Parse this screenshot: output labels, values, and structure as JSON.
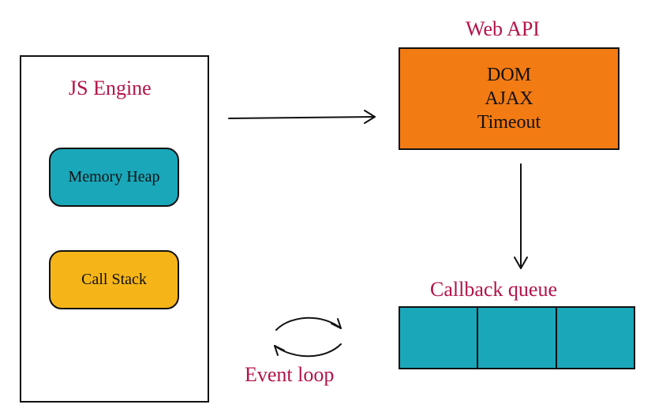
{
  "jsEngine": {
    "title": "JS Engine",
    "heapLabel": "Memory Heap",
    "stackLabel": "Call Stack"
  },
  "webApi": {
    "title": "Web API",
    "items": [
      "DOM",
      "AJAX",
      "Timeout"
    ]
  },
  "callbackQueue": {
    "title": "Callback queue",
    "slots": 3
  },
  "eventLoop": {
    "label": "Event loop"
  },
  "colors": {
    "pink": "#b4134a",
    "teal": "#1aa7ba",
    "orange": "#f37b13",
    "yellow": "#f5b518",
    "stroke": "#111111"
  }
}
